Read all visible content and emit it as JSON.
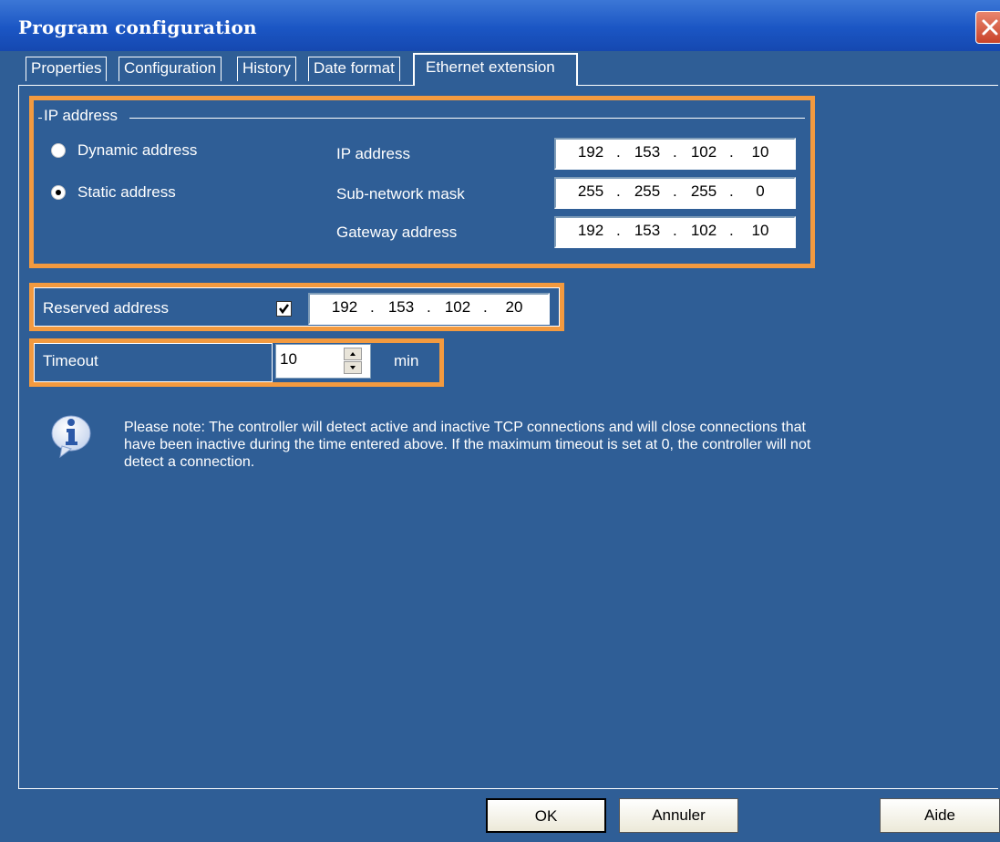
{
  "window": {
    "title": "Program configuration",
    "close_icon": "close-icon"
  },
  "tabs": [
    {
      "label": "Properties",
      "active": false
    },
    {
      "label": "Configuration",
      "active": false
    },
    {
      "label": "History",
      "active": false
    },
    {
      "label": "Date format",
      "active": false
    },
    {
      "label": "Ethernet extension",
      "active": true
    }
  ],
  "ip_group": {
    "legend": "IP address",
    "radio_dynamic": {
      "label": "Dynamic address",
      "selected": false
    },
    "radio_static": {
      "label": "Static address",
      "selected": true
    },
    "ip_address": {
      "label": "IP address",
      "octets": [
        "192",
        "153",
        "102",
        "10"
      ]
    },
    "subnet_mask": {
      "label": "Sub-network mask",
      "octets": [
        "255",
        "255",
        "255",
        "0"
      ]
    },
    "gateway": {
      "label": "Gateway address",
      "octets": [
        "192",
        "153",
        "102",
        "10"
      ]
    }
  },
  "reserved": {
    "label": "Reserved address",
    "checked": true,
    "octets": [
      "192",
      "153",
      "102",
      "20"
    ]
  },
  "timeout": {
    "label": "Timeout",
    "value": "10",
    "unit": "min"
  },
  "note": {
    "icon": "info-icon",
    "text": "Please note: The controller will detect active and inactive TCP connections and will close connections that have been inactive during the time entered above. If the maximum timeout is set at 0, the controller will not detect a connection."
  },
  "buttons": {
    "ok": "OK",
    "cancel": "Annuler",
    "help": "Aide"
  },
  "colors": {
    "background": "#2f5e96",
    "highlight": "#f39a3f",
    "titlebar": "#1b56c4"
  }
}
